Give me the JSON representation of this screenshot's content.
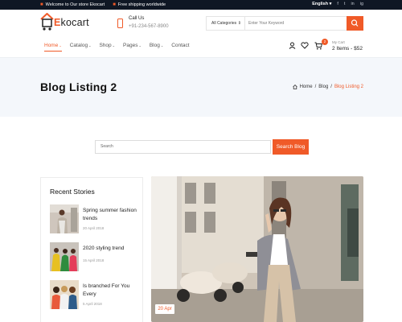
{
  "topbar": {
    "welcome": "Welcome to Our store Ekocart",
    "shipping": "Free shipping worldwide",
    "language": "English",
    "language_caret": "▾",
    "social": [
      "f",
      "t",
      "in",
      "ig"
    ]
  },
  "header": {
    "logo_first": "E",
    "logo_rest": "kocart",
    "call_label": "Call Us",
    "call_number": "+91-234-567-8900",
    "category": "All Categories",
    "category_caret": "⇕",
    "search_placeholder": "Enter Your Keyword"
  },
  "nav": {
    "items": [
      {
        "label": "Home",
        "arrow": "⌄"
      },
      {
        "label": "Catalog",
        "arrow": "⌄"
      },
      {
        "label": "Shop",
        "arrow": "⌄"
      },
      {
        "label": "Pages",
        "arrow": "⌄"
      },
      {
        "label": "Blog",
        "arrow": "⌄"
      },
      {
        "label": "Contact",
        "arrow": ""
      }
    ],
    "cart_count": "2",
    "cart_label": "My Cart",
    "cart_summary": "2 Items - $52"
  },
  "hero": {
    "title": "Blog Listing 2",
    "crumb_home": "Home",
    "crumb_sep": "/",
    "crumb_blog": "Blog",
    "crumb_current": "Blog Listing 2"
  },
  "blog_search": {
    "placeholder": "Search",
    "button": "Search Blog"
  },
  "sidebar": {
    "title": "Recent Stories",
    "stories": [
      {
        "title": "Spring summer fashion trends",
        "date": "20 April 2018"
      },
      {
        "title": "2020 styling trend",
        "date": "15 April 2018"
      },
      {
        "title": "Is branched For You Every",
        "date": "5 April 2018"
      }
    ]
  },
  "feature": {
    "date": "20 Apr"
  },
  "colors": {
    "accent": "#f05a28",
    "topbar": "#0f1724",
    "hero_bg": "#f4f7fb"
  },
  "icons": [
    "gift-icon",
    "truck-icon",
    "cart-logo-icon",
    "phone-icon",
    "search-icon",
    "user-icon",
    "heart-icon",
    "cart-icon",
    "home-icon"
  ]
}
